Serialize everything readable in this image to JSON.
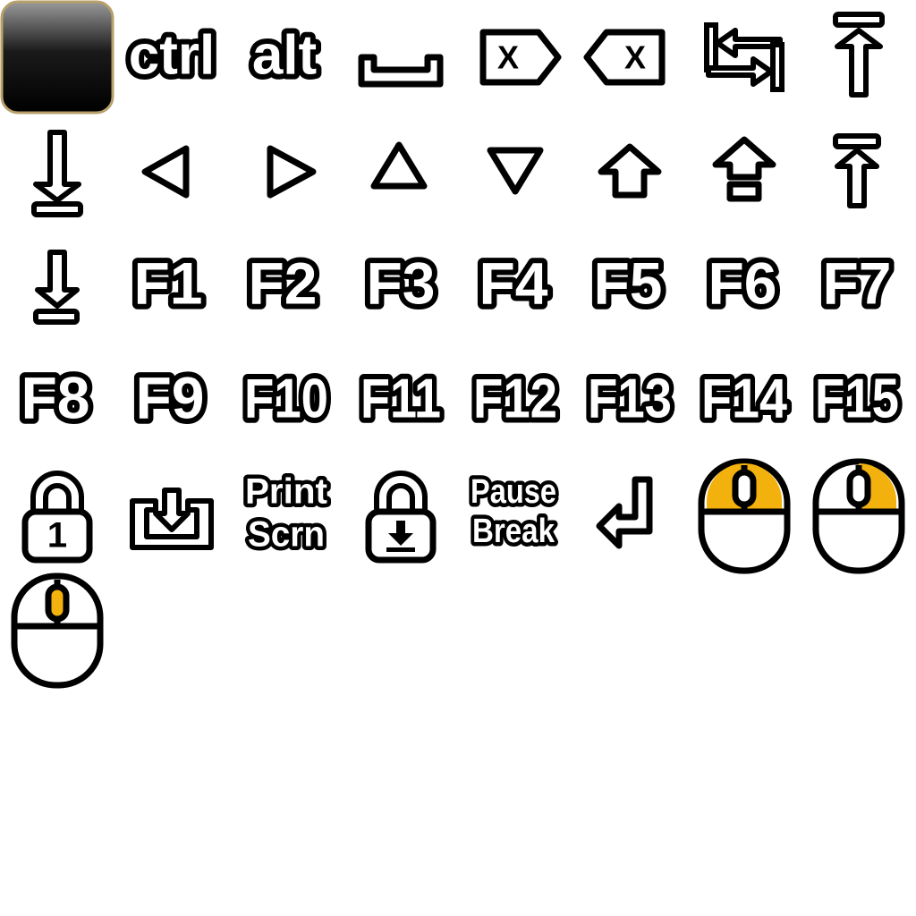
{
  "palette": {
    "outline": "#000000",
    "fill": "#ffffff",
    "accent": "#f2b10d",
    "blank_key_border": "#b7a06a"
  },
  "sheet": {
    "icons": [
      {
        "name": "blank-key-icon"
      },
      {
        "name": "ctrl-key-icon",
        "label": "ctrl"
      },
      {
        "name": "alt-key-icon",
        "label": "alt"
      },
      {
        "name": "space-key-icon"
      },
      {
        "name": "delete-key-icon",
        "label": "X"
      },
      {
        "name": "backspace-key-icon",
        "label": "X"
      },
      {
        "name": "tab-key-icon"
      },
      {
        "name": "home-key-icon"
      },
      {
        "name": "end-key-icon"
      },
      {
        "name": "arrow-left-icon"
      },
      {
        "name": "arrow-right-icon"
      },
      {
        "name": "arrow-up-icon"
      },
      {
        "name": "arrow-down-icon"
      },
      {
        "name": "shift-key-icon"
      },
      {
        "name": "shift-key-alt-icon"
      },
      {
        "name": "page-up-icon"
      },
      {
        "name": "page-down-icon"
      },
      {
        "name": "f1-key-icon",
        "label": "F1"
      },
      {
        "name": "f2-key-icon",
        "label": "F2"
      },
      {
        "name": "f3-key-icon",
        "label": "F3"
      },
      {
        "name": "f4-key-icon",
        "label": "F4"
      },
      {
        "name": "f5-key-icon",
        "label": "F5"
      },
      {
        "name": "f6-key-icon",
        "label": "F6"
      },
      {
        "name": "f7-key-icon",
        "label": "F7"
      },
      {
        "name": "f8-key-icon",
        "label": "F8"
      },
      {
        "name": "f9-key-icon",
        "label": "F9"
      },
      {
        "name": "f10-key-icon",
        "label": "F10"
      },
      {
        "name": "f11-key-icon",
        "label": "F11"
      },
      {
        "name": "f12-key-icon",
        "label": "F12"
      },
      {
        "name": "f13-key-icon",
        "label": "F13"
      },
      {
        "name": "f14-key-icon",
        "label": "F14"
      },
      {
        "name": "f15-key-icon",
        "label": "F15"
      },
      {
        "name": "num-lock-icon",
        "label": "1"
      },
      {
        "name": "insert-key-icon"
      },
      {
        "name": "print-screen-key-icon",
        "label_line1": "Print",
        "label_line2": "Scrn"
      },
      {
        "name": "scroll-lock-icon"
      },
      {
        "name": "pause-break-key-icon",
        "label_line1": "Pause",
        "label_line2": "Break"
      },
      {
        "name": "enter-key-icon"
      },
      {
        "name": "mouse-left-click-icon"
      },
      {
        "name": "mouse-right-click-icon"
      },
      {
        "name": "mouse-middle-click-icon"
      }
    ]
  }
}
